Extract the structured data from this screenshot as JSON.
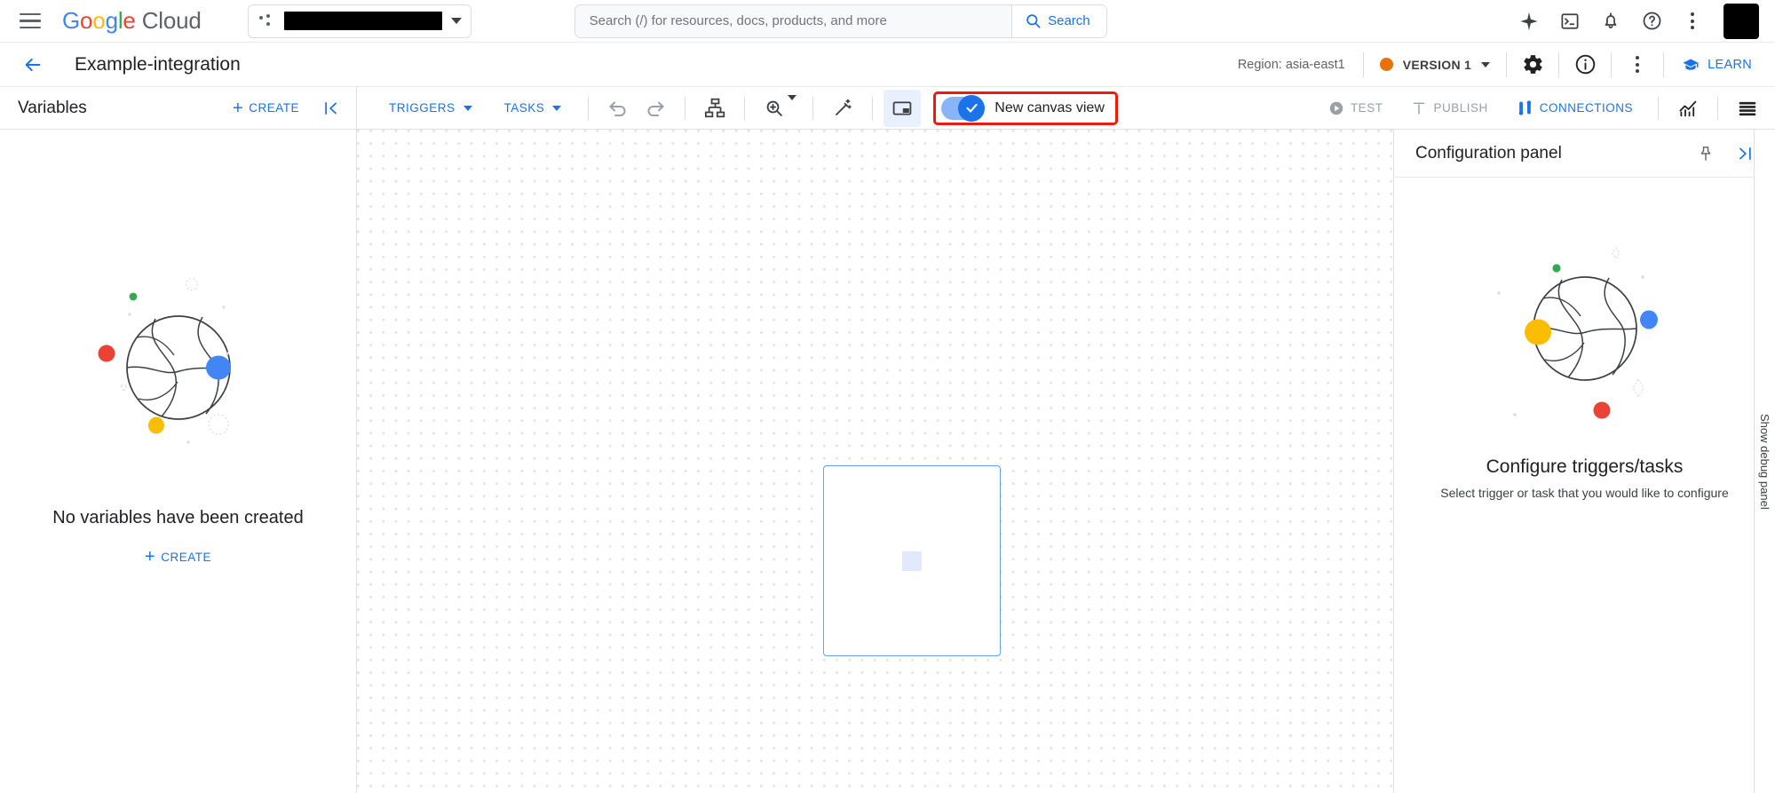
{
  "topbar": {
    "menu_icon": "hamburger-icon",
    "brand": {
      "google": "Google",
      "cloud": "Cloud"
    },
    "project_selector": {
      "value": "",
      "redacted": true
    },
    "search": {
      "placeholder": "Search (/) for resources, docs, products, and more",
      "value": "",
      "button_label": "Search"
    },
    "icons": [
      "gemini-sparkle-icon",
      "cloud-shell-icon",
      "notifications-bell-icon",
      "help-icon",
      "more-vert-icon"
    ],
    "avatar": {
      "redacted": true
    }
  },
  "subheader": {
    "back_label": "back-arrow",
    "title": "Example-integration",
    "region": "Region: asia-east1",
    "version": {
      "label": "VERSION 1",
      "status_color": "#e8710a"
    },
    "settings_icon": "gear-icon",
    "info_icon": "info-icon",
    "more_icon": "more-vert-icon",
    "learn_label": "LEARN"
  },
  "toolbar": {
    "variables_title": "Variables",
    "create_label": "CREATE",
    "collapse_icon": "collapse-left-icon",
    "triggers_label": "TRIGGERS",
    "tasks_label": "TASKS",
    "undo_icon": "undo-icon",
    "redo_icon": "redo-icon",
    "layout_icon": "auto-layout-icon",
    "zoom_icon": "zoom-in-icon",
    "magic_icon": "magic-wand-icon",
    "panel_icon": "toggle-panel-icon",
    "canvas_toggle": {
      "label": "New canvas view",
      "checked": true,
      "highlight_color": "#ea1c0d"
    },
    "test_label": "TEST",
    "publish_label": "PUBLISH",
    "connections_label": "CONNECTIONS",
    "analytics_icon": "analytics-chart-icon",
    "logs_icon": "logs-list-icon"
  },
  "left_panel": {
    "empty_title": "No variables have been created",
    "create_label": "CREATE"
  },
  "right_panel": {
    "title": "Configuration panel",
    "pin_icon": "pin-icon",
    "collapse_icon": "collapse-right-icon",
    "empty_title": "Configure triggers/tasks",
    "empty_subtitle": "Select trigger or task that you would like to configure"
  },
  "debug_rail": {
    "label": "Show debug panel"
  },
  "colors": {
    "brand_blue": "#1a73e8",
    "google_red": "#ea4335",
    "google_yellow": "#fbbc04",
    "google_green": "#34a853",
    "version_orange": "#e8710a",
    "highlight_red": "#ea1c0d",
    "node_border": "#669df6"
  }
}
